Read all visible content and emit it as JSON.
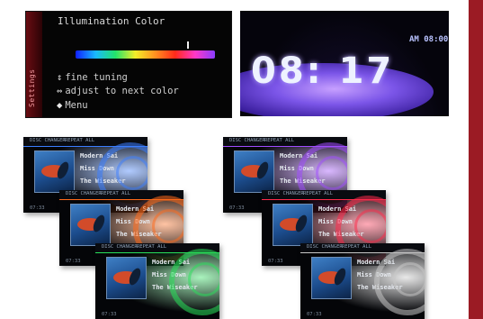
{
  "illumination": {
    "side_label": "Settings",
    "title": "Illumination Color",
    "lines": [
      {
        "icon": "up-down-arrows-icon",
        "glyph": "⇕",
        "text": "fine tuning"
      },
      {
        "icon": "left-right-arrows-icon",
        "glyph": "⇔",
        "text": "adjust to next color"
      },
      {
        "icon": "diamond-icon",
        "glyph": "◆",
        "text": "Menu"
      }
    ]
  },
  "clock": {
    "small_time": "AM 08:00",
    "big_time": "08: 17"
  },
  "media": {
    "tracks": [
      "Modern Sai",
      "Miss Down",
      "The Wiseaker"
    ],
    "source_label": "DISC CHANGER",
    "status_label": "REPEAT ALL",
    "elapsed": "07:33"
  },
  "screens": [
    {
      "theme": "blue",
      "color": "#3b7dff"
    },
    {
      "theme": "purple",
      "color": "#a04cff"
    },
    {
      "theme": "orange",
      "color": "#ff6a1a"
    },
    {
      "theme": "red",
      "color": "#ff2a4a"
    },
    {
      "theme": "green",
      "color": "#28e05a"
    },
    {
      "theme": "gray",
      "color": "#c7c7c7"
    }
  ],
  "colors": {
    "accent": "#9b1b24"
  }
}
